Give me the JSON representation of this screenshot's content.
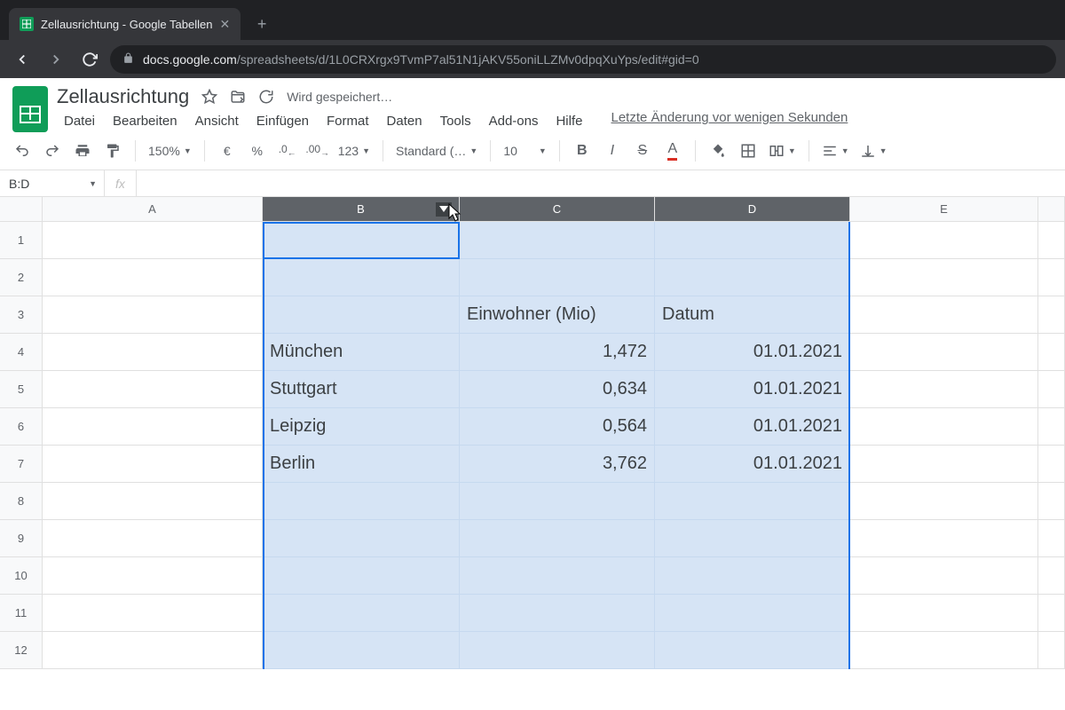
{
  "browser": {
    "tab_title": "Zellausrichtung - Google Tabellen",
    "url_host": "docs.google.com",
    "url_path": "/spreadsheets/d/1L0CRXrgx9TvmP7al51N1jAKV55oniLLZMv0dpqXuYps/edit#gid=0"
  },
  "header": {
    "doc_title": "Zellausrichtung",
    "saving_text": "Wird gespeichert…",
    "menus": [
      "Datei",
      "Bearbeiten",
      "Ansicht",
      "Einfügen",
      "Format",
      "Daten",
      "Tools",
      "Add-ons",
      "Hilfe"
    ],
    "last_edit": "Letzte Änderung vor wenigen Sekunden"
  },
  "toolbar": {
    "zoom": "150%",
    "currency": "€",
    "percent": "%",
    "dec_dec": ".0",
    "inc_dec": ".00",
    "num_format": "123",
    "font": "Standard (…",
    "font_size": "10",
    "bold": "B",
    "italic": "I",
    "strike": "S",
    "text_color": "A"
  },
  "formula_bar": {
    "name_box": "B:D",
    "fx_label": "fx"
  },
  "columns": [
    "A",
    "B",
    "C",
    "D",
    "E"
  ],
  "selected_columns": [
    "B",
    "C",
    "D"
  ],
  "rows": [
    "1",
    "2",
    "3",
    "4",
    "5",
    "6",
    "7",
    "8",
    "9",
    "10",
    "11",
    "12"
  ],
  "cells": {
    "C3": "Einwohner (Mio)",
    "D3": "Datum",
    "B4": "München",
    "C4": "1,472",
    "D4": "01.01.2021",
    "B5": "Stuttgart",
    "C5": "0,634",
    "D5": "01.01.2021",
    "B6": "Leipzig",
    "C6": "0,564",
    "D6": "01.01.2021",
    "B7": "Berlin",
    "C7": "3,762",
    "D7": "01.01.2021"
  }
}
